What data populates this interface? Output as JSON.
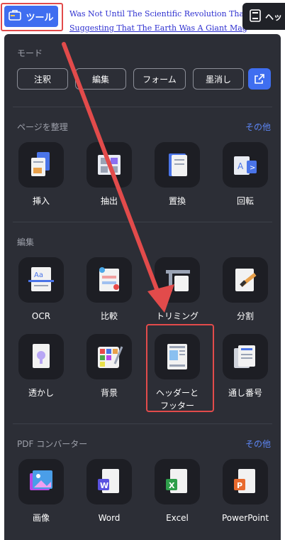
{
  "toolbar": {
    "tools_label": "ツール"
  },
  "background_doc": {
    "lines": [
      "Was Not Until The Scientific Revolution That Mod",
      "Suggesting That The Earth Was A Giant Magnet. Over Time,"
    ]
  },
  "header_footer_tab": {
    "label": "ヘッ"
  },
  "mode": {
    "title": "モード",
    "buttons": [
      "注釈",
      "編集",
      "フォーム",
      "墨消し"
    ]
  },
  "organize": {
    "title": "ページを整理",
    "more": "その他",
    "tools": [
      "挿入",
      "抽出",
      "置換",
      "回転"
    ]
  },
  "edit": {
    "title": "編集",
    "tools": [
      "OCR",
      "比較",
      "トリミング",
      "分割",
      "透かし",
      "背景",
      "ヘッダーと",
      "フッター",
      "通し番号"
    ]
  },
  "converter": {
    "title": "PDF コンバーター",
    "more": "その他",
    "tools": [
      "画像",
      "Word",
      "Excel",
      "PowerPoint"
    ]
  },
  "colors": {
    "accent": "#3f6ef0",
    "highlight": "#e24b4b",
    "panel": "#2c2e36",
    "tile": "#1d1e24",
    "link": "#5d86f5"
  }
}
